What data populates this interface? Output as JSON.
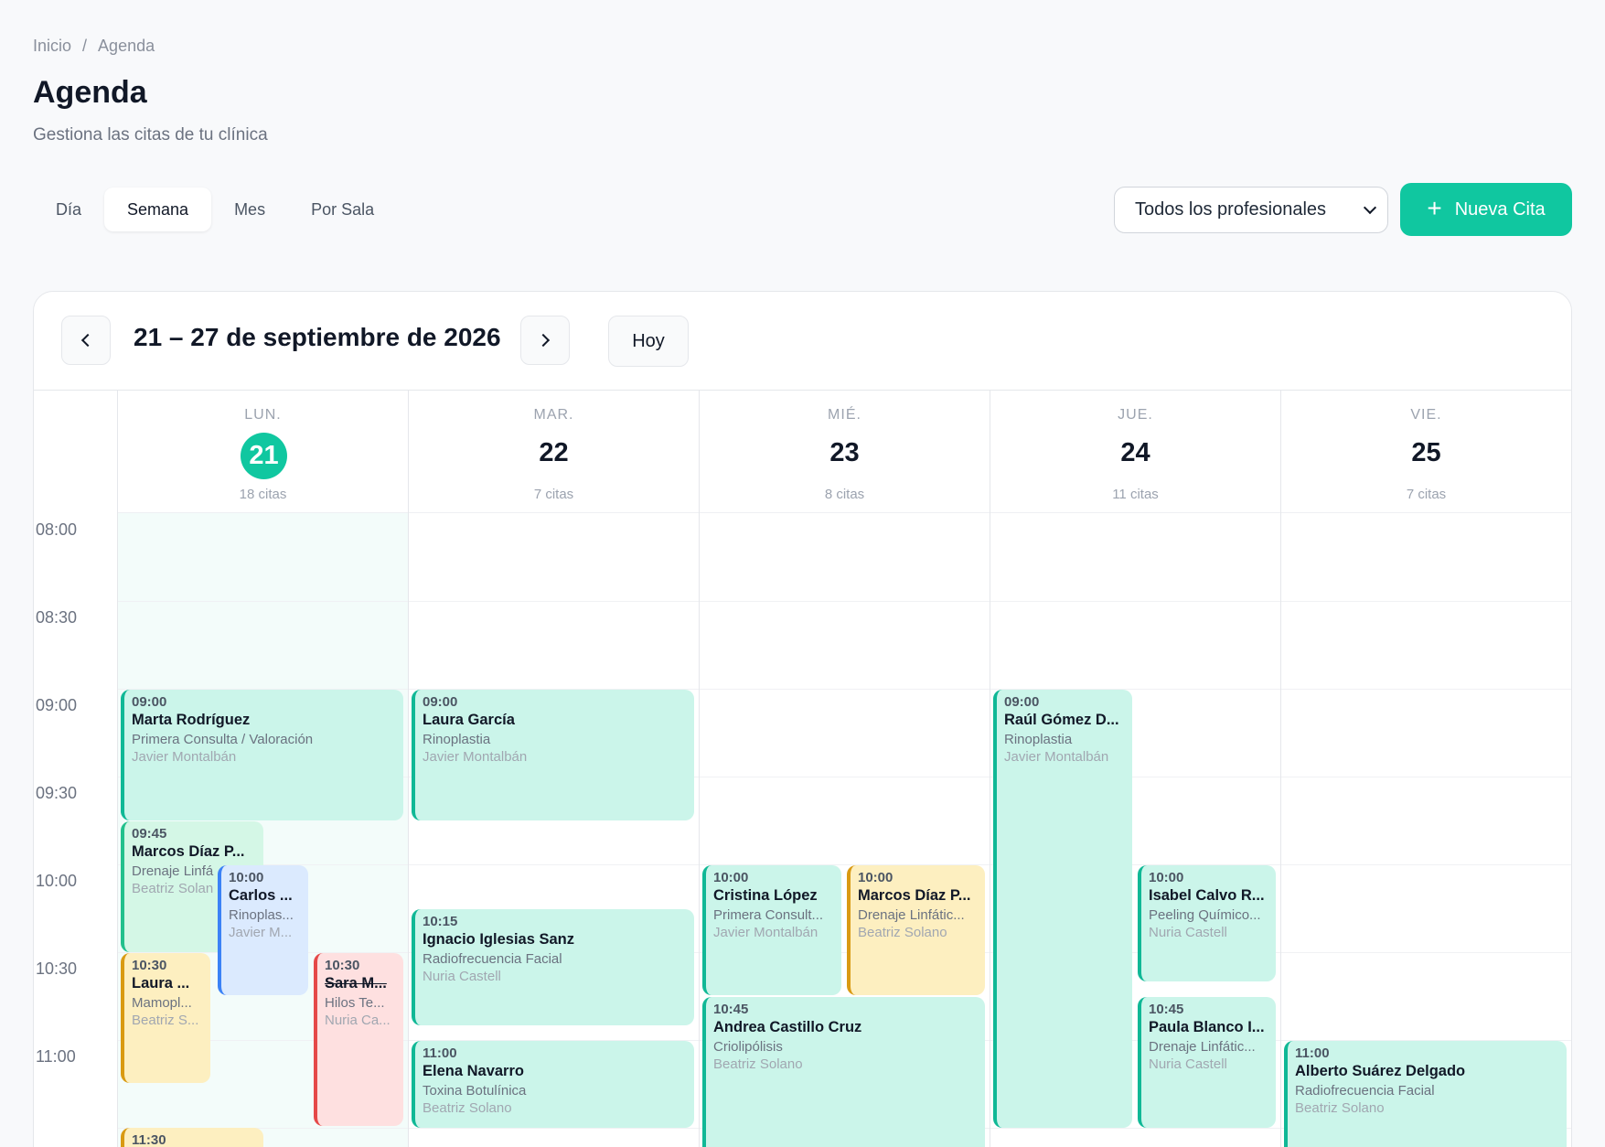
{
  "breadcrumb": {
    "home": "Inicio",
    "separator": "/",
    "current": "Agenda"
  },
  "page": {
    "title": "Agenda",
    "subtitle": "Gestiona las citas de tu clínica"
  },
  "view_tabs": [
    {
      "label": "Día",
      "active": false
    },
    {
      "label": "Semana",
      "active": true
    },
    {
      "label": "Mes",
      "active": false
    },
    {
      "label": "Por Sala",
      "active": false
    }
  ],
  "professional_select": {
    "value": "Todos los profesionales"
  },
  "new_appointment": {
    "icon": "plus-icon",
    "label": "Nueva Cita"
  },
  "calendar": {
    "range_title": "21 – 27 de septiembre de 2026",
    "today_label": "Hoy",
    "time_slots": [
      "08:00",
      "08:30",
      "09:00",
      "09:30",
      "10:00",
      "10:30",
      "11:00"
    ],
    "days": [
      {
        "name": "LUN.",
        "number": "21",
        "count": "18 citas",
        "today": true
      },
      {
        "name": "MAR.",
        "number": "22",
        "count": "7 citas",
        "today": false
      },
      {
        "name": "MIÉ.",
        "number": "23",
        "count": "8 citas",
        "today": false
      },
      {
        "name": "JUE.",
        "number": "24",
        "count": "11 citas",
        "today": false
      },
      {
        "name": "VIE.",
        "number": "25",
        "count": "7 citas",
        "today": false
      }
    ],
    "appointments": [
      {
        "time": "09:00",
        "name": "Marta Rodríguez",
        "service": "Primera Consulta / Valoración",
        "professional": "Javier Montalbán",
        "color": "#cbf5ea"
      },
      {
        "time": "09:45",
        "name": "Marcos Díaz P...",
        "service": "Drenaje Linfá",
        "professional": "Beatriz Solan",
        "color": "#d4f7e6"
      },
      {
        "time": "10:00",
        "name": "Carlos ...",
        "service": "Rinoplas...",
        "professional": "Javier M...",
        "color": "#dbeafe"
      },
      {
        "time": "10:30",
        "name": "Laura ...",
        "service": "Mamopl...",
        "professional": "Beatriz S...",
        "color": "#fdefc0"
      },
      {
        "time": "10:30",
        "name": "Sara M...",
        "service": "Hilos Te...",
        "professional": "Nuria Ca...",
        "color": "#fee0e0"
      },
      {
        "time": "11:30",
        "name": "",
        "service": "",
        "professional": "",
        "color": "#fdefc0"
      },
      {
        "time": "09:00",
        "name": "Laura García",
        "service": "Rinoplastia",
        "professional": "Javier Montalbán",
        "color": "#cbf5ea"
      },
      {
        "time": "10:15",
        "name": "Ignacio Iglesias Sanz",
        "service": "Radiofrecuencia Facial",
        "professional": "Nuria Castell",
        "color": "#cbf5ea"
      },
      {
        "time": "11:00",
        "name": "Elena Navarro",
        "service": "Toxina Botulínica",
        "professional": "Beatriz Solano",
        "color": "#cbf5ea"
      },
      {
        "time": "10:00",
        "name": "Cristina López",
        "service": "Primera Consult...",
        "professional": "Javier Montalbán",
        "color": "#cbf5ea"
      },
      {
        "time": "10:00",
        "name": "Marcos Díaz P...",
        "service": "Drenaje Linfátic...",
        "professional": "Beatriz Solano",
        "color": "#fdefc0"
      },
      {
        "time": "10:45",
        "name": "Andrea Castillo Cruz",
        "service": "Criolipólisis",
        "professional": "Beatriz Solano",
        "color": "#cbf5ea"
      },
      {
        "time": "09:00",
        "name": "Raúl Gómez D...",
        "service": "Rinoplastia",
        "professional": "Javier Montalbán",
        "color": "#cbf5ea"
      },
      {
        "time": "10:00",
        "name": "Isabel Calvo R...",
        "service": "Peeling Químico...",
        "professional": "Nuria Castell",
        "color": "#cbf5ea"
      },
      {
        "time": "10:45",
        "name": "Paula Blanco I...",
        "service": "Drenaje Linfátic...",
        "professional": "Nuria Castell",
        "color": "#cbf5ea"
      },
      {
        "time": "11:00",
        "name": "Alberto Suárez Delgado",
        "service": "Radiofrecuencia Facial",
        "professional": "Beatriz Solano",
        "color": "#cbf5ea"
      }
    ]
  }
}
